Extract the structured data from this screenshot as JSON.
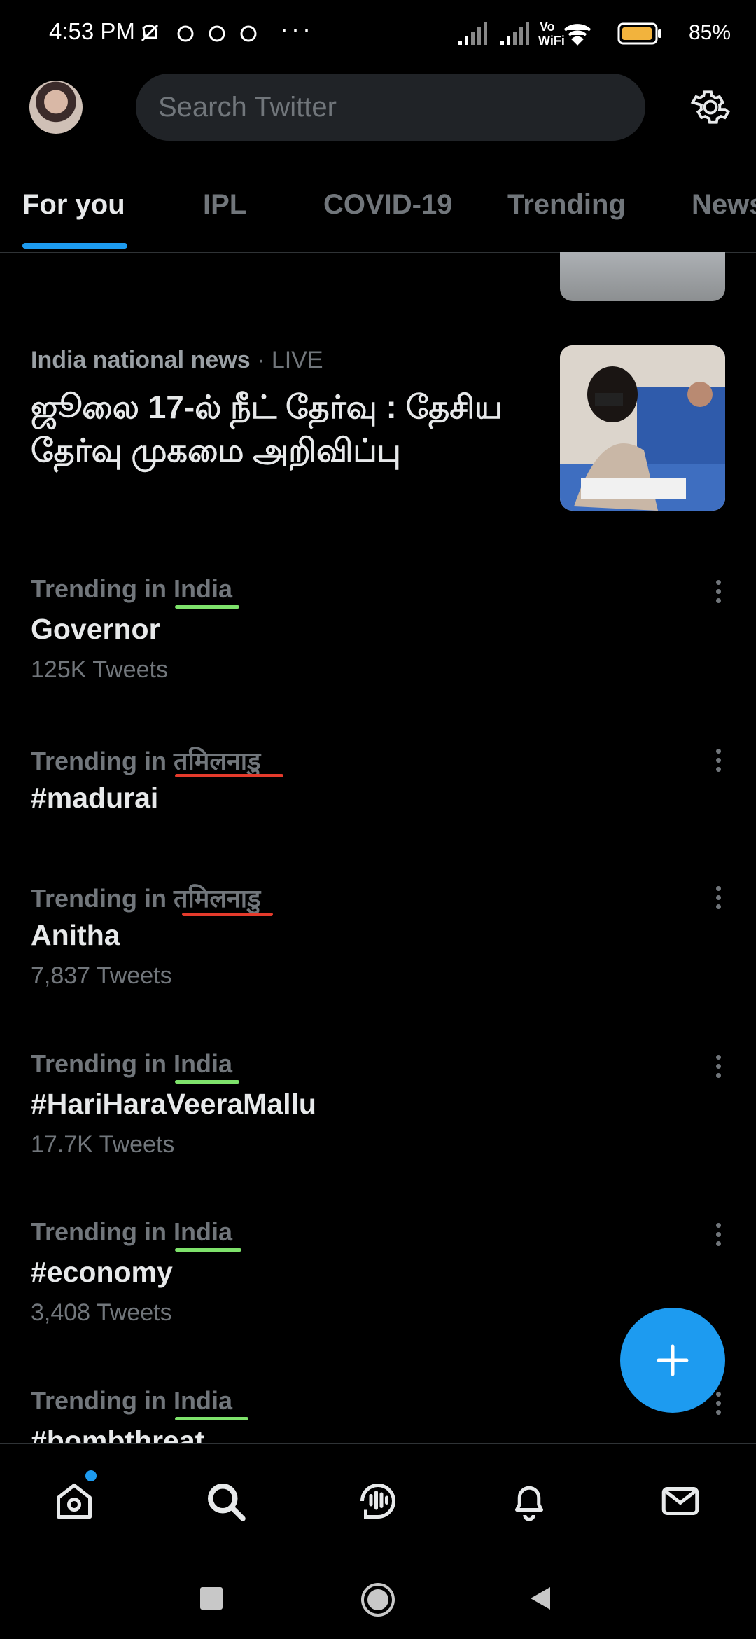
{
  "status": {
    "time": "4:53 PM",
    "battery": "85%"
  },
  "search": {
    "placeholder": "Search Twitter"
  },
  "tabs": [
    {
      "label": "For you"
    },
    {
      "label": "IPL"
    },
    {
      "label": "COVID-19"
    },
    {
      "label": "Trending"
    },
    {
      "label": "News"
    }
  ],
  "news": {
    "source": "India national news",
    "live": "· LIVE",
    "title": "ஜூலை 17-ல் நீட் தேர்வு : தேசிய தேர்வு முகமை அறிவிப்பு"
  },
  "trends": [
    {
      "context_prefix": "Trending in",
      "location": "India",
      "name": "Governor",
      "count": "125K Tweets",
      "underline": "#7ee26b"
    },
    {
      "context_prefix": "Trending in",
      "location": "तमिलनाडु",
      "name": "#madurai",
      "count": "",
      "underline": "#e53b2c"
    },
    {
      "context_prefix": "Trending in",
      "location": "तमिलनाडु",
      "name": "Anitha",
      "count": "7,837 Tweets",
      "underline": "#e53b2c"
    },
    {
      "context_prefix": "Trending in",
      "location": "India",
      "name": "#HariHaraVeeraMallu",
      "count": "17.7K Tweets",
      "underline": "#7ee26b"
    },
    {
      "context_prefix": "Trending in",
      "location": "India",
      "name": "#economy",
      "count": "3,408 Tweets",
      "underline": "#7ee26b"
    },
    {
      "context_prefix": "Trending in",
      "location": "India",
      "name": "#bombthreat",
      "count": "",
      "underline": "#7ee26b"
    }
  ],
  "icons": {
    "settings": "gear-icon",
    "compose": "plus-icon",
    "home": "home-icon",
    "explore": "search-icon",
    "spaces": "spaces-icon",
    "notifications": "bell-icon",
    "messages": "mail-icon"
  },
  "colors": {
    "accent": "#1d9bf0",
    "background": "#000000",
    "muted": "#71767b"
  }
}
